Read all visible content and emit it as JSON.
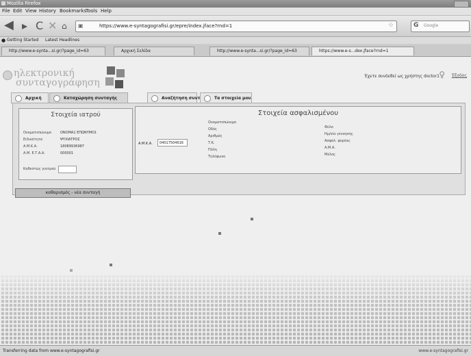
{
  "window": {
    "title": "Mozilla Firefox"
  },
  "menu": [
    "File",
    "Edit",
    "View",
    "History",
    "Bookmarks",
    "Tools",
    "Help"
  ],
  "address": {
    "url": "https://www.e-syntagografisi.gr/epre/index.jface?rnd=1"
  },
  "search": {
    "placeholder": "Google"
  },
  "bookmarks": [
    "Getting Started",
    "Latest Headlines"
  ],
  "browser_tabs": [
    {
      "label": "http://www.e-synta...si.gr/?page_id=63"
    },
    {
      "label": "Αρχική Σελίδα"
    },
    {
      "label": "http://www.e-synta...si.gr/?page_id=63"
    },
    {
      "label": "https://www.e-s...dex.jface?rnd=1"
    }
  ],
  "site": {
    "logo_line1": "ηλεκτρονική",
    "logo_line2": "συνταγογράφηση",
    "welcome": "Έχετε συνδεθεί ως χρήστης doctor1",
    "logout": "Έξοδος"
  },
  "app_tabs": [
    "Αρχική",
    "Καταχώρηση συνταγής",
    "Αναζήτηση συνταγής",
    "Τα στοιχεία μου"
  ],
  "doctor": {
    "title": "Στοιχεία ιατρού",
    "fields": [
      {
        "label": "Ονοματεπώνυμο",
        "value": "ΟΝΟΜΑ1 ΕΠΩΝΥΜΟ1"
      },
      {
        "label": "Ειδικότητα",
        "value": "ΨΥΧΙΑΤΡΟΣ"
      },
      {
        "label": "Α.Μ.Κ.Α.",
        "value": "18089936987"
      },
      {
        "label": "Α.Μ. Ε.Τ.Α.Α.",
        "value": "000001"
      }
    ],
    "specialty_label": "Καθεστώς γιατρού"
  },
  "insured": {
    "title": "Στοιχεία ασφαλισμένου",
    "amka_label": "Α.Μ.Κ.Α.",
    "amka_value": "04017504616",
    "left_fields": [
      "Ονοματεπώνυμο",
      "Οδός",
      "Αριθμός",
      "Τ.Κ.",
      "Πόλη",
      "Τηλέφωνο"
    ],
    "right_fields": [
      "Φύλο",
      "Ημ/νία γέννησης",
      "Ασφαλ. φορέας",
      "Α.Μ.Α.",
      "Μέλος"
    ]
  },
  "new_prescription_button": "καθαρισμός - νέα συνταγή",
  "status": {
    "text": "Transferring data from www.e-syntagografisi.gr",
    "right": "www.e-syntagografisi.gr"
  }
}
